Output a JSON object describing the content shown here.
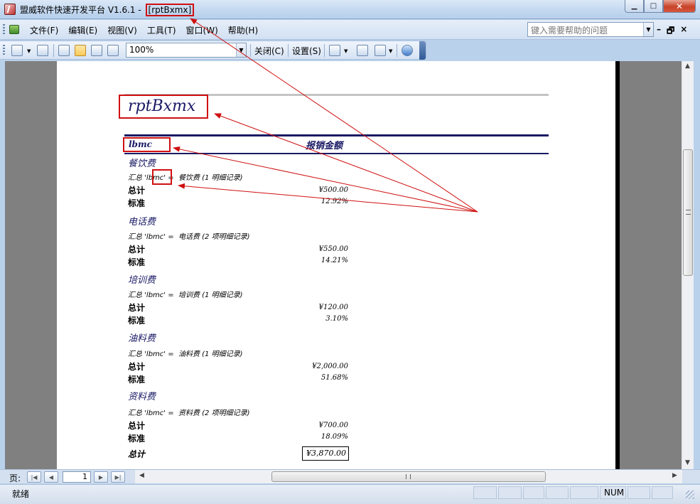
{
  "window": {
    "title": "盟威软件快速开发平台 V1.6.1 - ",
    "document": "[rptBxmx]",
    "min_label": "▁",
    "max_label": "□",
    "close_label": "✕"
  },
  "menu": {
    "items": [
      "文件(F)",
      "编辑(E)",
      "视图(V)",
      "工具(T)",
      "窗口(W)",
      "帮助(H)"
    ],
    "help_placeholder": "键入需要帮助的问题",
    "mdi_min": "–",
    "mdi_restore": "🗗",
    "mdi_close": "×"
  },
  "toolbar": {
    "zoom": "100%",
    "close_label": "关闭(C)",
    "settings_label": "设置(S)"
  },
  "report": {
    "title": "rptBxmx",
    "col1": "lbmc",
    "col2": "报销金额",
    "total_label": "总计",
    "std_label": "标准",
    "groups": [
      {
        "name": "餐饮费",
        "summary": "汇总 'lbmc' =  餐饮费 (1 明细记录)",
        "total": "¥500.00",
        "std": "12.92%"
      },
      {
        "name": "电话费",
        "summary": "汇总 'lbmc' =  电话费 (2 项明细记录)",
        "total": "¥550.00",
        "std": "14.21%"
      },
      {
        "name": "培训费",
        "summary": "汇总 'lbmc' =  培训费 (1 明细记录)",
        "total": "¥120.00",
        "std": "3.10%"
      },
      {
        "name": "油料费",
        "summary": "汇总 'lbmc' =  油料费 (1 明细记录)",
        "total": "¥2,000.00",
        "std": "51.68%"
      },
      {
        "name": "资料费",
        "summary": "汇总 'lbmc' =  资料费 (2 项明细记录)",
        "total": "¥700.00",
        "std": "18.09%"
      }
    ],
    "grand_label": "总计",
    "grand_total": "¥3,870.00"
  },
  "nav": {
    "page_label": "页:",
    "page_value": "1"
  },
  "status": {
    "text": "就绪",
    "num": "NUM"
  },
  "colors": {
    "annotation_red": "#d01010",
    "report_navy": "#1a1a66"
  }
}
